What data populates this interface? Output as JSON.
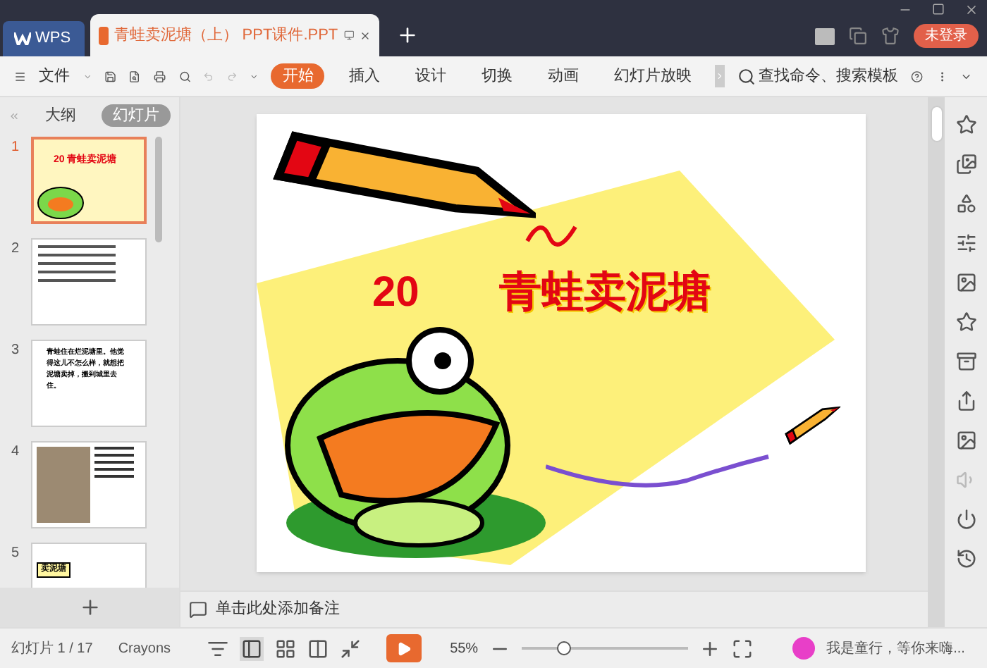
{
  "tabs": [
    {
      "label": "WPS",
      "kind": "home",
      "selected": false
    },
    {
      "label": "青蛙卖泥塘（上） PPT课件.PPT",
      "kind": "doc",
      "selected": true
    }
  ],
  "login_button": "未登录",
  "menu": {
    "file": "文件",
    "search": "查找命令、搜索模板",
    "ribbon_tabs": [
      {
        "label": "开始",
        "selected": true
      },
      {
        "label": "插入",
        "selected": false
      },
      {
        "label": "设计",
        "selected": false
      },
      {
        "label": "切换",
        "selected": false
      },
      {
        "label": "动画",
        "selected": false
      },
      {
        "label": "幻灯片放映",
        "selected": false
      }
    ]
  },
  "panel_tabs": [
    {
      "label": "大纲",
      "selected": false
    },
    {
      "label": "幻灯片",
      "selected": true
    }
  ],
  "slides": [
    {
      "number": "1",
      "kind": "title",
      "selected": true,
      "text": "20 青蛙卖泥塘"
    },
    {
      "number": "2",
      "kind": "words",
      "selected": false
    },
    {
      "number": "3",
      "kind": "paragraph",
      "selected": false,
      "text": "青蛙住在烂泥塘里。他觉得这儿不怎么样，就想把泥塘卖掉，搬到城里去住。"
    },
    {
      "number": "4",
      "kind": "photo",
      "selected": false
    },
    {
      "number": "5",
      "kind": "heading",
      "selected": false,
      "text": "卖泥塘"
    }
  ],
  "slide": {
    "number": "20",
    "title": "青蛙卖泥塘"
  },
  "notes_placeholder": "单击此处添加备注",
  "status_bar": {
    "slide_count": "幻灯片 1 / 17",
    "theme": "Crayons",
    "zoom": "55%",
    "level": 0.25,
    "user_text": "我是童行，等你来嗨..."
  }
}
